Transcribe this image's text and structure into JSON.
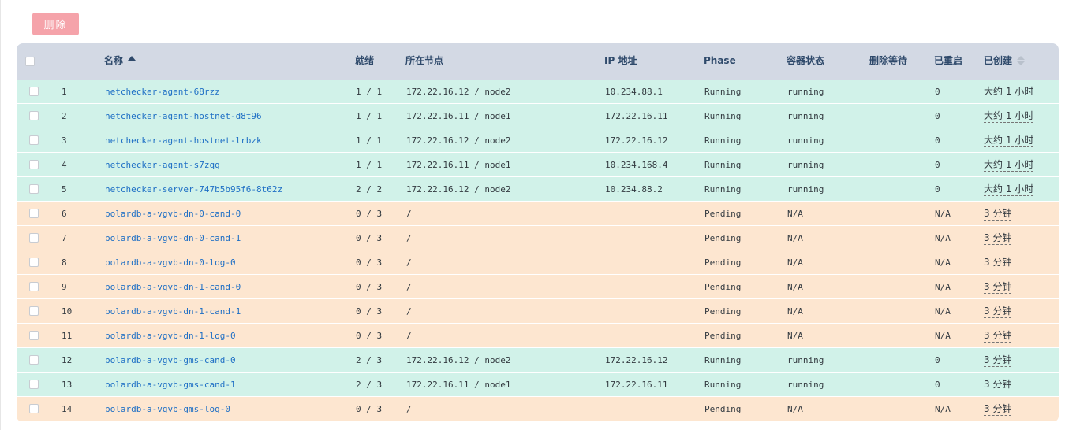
{
  "toolbar": {
    "delete_label": "删除"
  },
  "table": {
    "headers": {
      "name": "名称",
      "ready": "就绪",
      "node": "所在节点",
      "ip": "IP 地址",
      "phase": "Phase",
      "container_state": "容器状态",
      "delete_wait": "删除等待",
      "restarts": "已重启",
      "created": "已创建"
    },
    "rows": [
      {
        "index": "1",
        "name": "netchecker-agent-68rzz",
        "ready": "1 / 1",
        "node": "172.22.16.12 / node2",
        "ip": "10.234.88.1",
        "phase": "Running",
        "container_state": "running",
        "delete_wait": "",
        "restarts": "0",
        "created": "大约 1 小时",
        "status": "running"
      },
      {
        "index": "2",
        "name": "netchecker-agent-hostnet-d8t96",
        "ready": "1 / 1",
        "node": "172.22.16.11 / node1",
        "ip": "172.22.16.11",
        "phase": "Running",
        "container_state": "running",
        "delete_wait": "",
        "restarts": "0",
        "created": "大约 1 小时",
        "status": "running"
      },
      {
        "index": "3",
        "name": "netchecker-agent-hostnet-lrbzk",
        "ready": "1 / 1",
        "node": "172.22.16.12 / node2",
        "ip": "172.22.16.12",
        "phase": "Running",
        "container_state": "running",
        "delete_wait": "",
        "restarts": "0",
        "created": "大约 1 小时",
        "status": "running"
      },
      {
        "index": "4",
        "name": "netchecker-agent-s7zqg",
        "ready": "1 / 1",
        "node": "172.22.16.11 / node1",
        "ip": "10.234.168.4",
        "phase": "Running",
        "container_state": "running",
        "delete_wait": "",
        "restarts": "0",
        "created": "大约 1 小时",
        "status": "running"
      },
      {
        "index": "5",
        "name": "netchecker-server-747b5b95f6-8t62z",
        "ready": "2 / 2",
        "node": "172.22.16.12 / node2",
        "ip": "10.234.88.2",
        "phase": "Running",
        "container_state": "running",
        "delete_wait": "",
        "restarts": "0",
        "created": "大约 1 小时",
        "status": "running"
      },
      {
        "index": "6",
        "name": "polardb-a-vgvb-dn-0-cand-0",
        "ready": "0 / 3",
        "node": "/",
        "ip": "",
        "phase": "Pending",
        "container_state": "N/A",
        "delete_wait": "",
        "restarts": "N/A",
        "created": "3 分钟",
        "status": "pending"
      },
      {
        "index": "7",
        "name": "polardb-a-vgvb-dn-0-cand-1",
        "ready": "0 / 3",
        "node": "/",
        "ip": "",
        "phase": "Pending",
        "container_state": "N/A",
        "delete_wait": "",
        "restarts": "N/A",
        "created": "3 分钟",
        "status": "pending"
      },
      {
        "index": "8",
        "name": "polardb-a-vgvb-dn-0-log-0",
        "ready": "0 / 3",
        "node": "/",
        "ip": "",
        "phase": "Pending",
        "container_state": "N/A",
        "delete_wait": "",
        "restarts": "N/A",
        "created": "3 分钟",
        "status": "pending"
      },
      {
        "index": "9",
        "name": "polardb-a-vgvb-dn-1-cand-0",
        "ready": "0 / 3",
        "node": "/",
        "ip": "",
        "phase": "Pending",
        "container_state": "N/A",
        "delete_wait": "",
        "restarts": "N/A",
        "created": "3 分钟",
        "status": "pending"
      },
      {
        "index": "10",
        "name": "polardb-a-vgvb-dn-1-cand-1",
        "ready": "0 / 3",
        "node": "/",
        "ip": "",
        "phase": "Pending",
        "container_state": "N/A",
        "delete_wait": "",
        "restarts": "N/A",
        "created": "3 分钟",
        "status": "pending"
      },
      {
        "index": "11",
        "name": "polardb-a-vgvb-dn-1-log-0",
        "ready": "0 / 3",
        "node": "/",
        "ip": "",
        "phase": "Pending",
        "container_state": "N/A",
        "delete_wait": "",
        "restarts": "N/A",
        "created": "3 分钟",
        "status": "pending"
      },
      {
        "index": "12",
        "name": "polardb-a-vgvb-gms-cand-0",
        "ready": "2 / 3",
        "node": "172.22.16.12 / node2",
        "ip": "172.22.16.12",
        "phase": "Running",
        "container_state": "running",
        "delete_wait": "",
        "restarts": "0",
        "created": "3 分钟",
        "status": "running"
      },
      {
        "index": "13",
        "name": "polardb-a-vgvb-gms-cand-1",
        "ready": "2 / 3",
        "node": "172.22.16.11 / node1",
        "ip": "172.22.16.11",
        "phase": "Running",
        "container_state": "running",
        "delete_wait": "",
        "restarts": "0",
        "created": "3 分钟",
        "status": "running"
      },
      {
        "index": "14",
        "name": "polardb-a-vgvb-gms-log-0",
        "ready": "0 / 3",
        "node": "/",
        "ip": "",
        "phase": "Pending",
        "container_state": "N/A",
        "delete_wait": "",
        "restarts": "N/A",
        "created": "3 分钟",
        "status": "pending"
      }
    ]
  }
}
